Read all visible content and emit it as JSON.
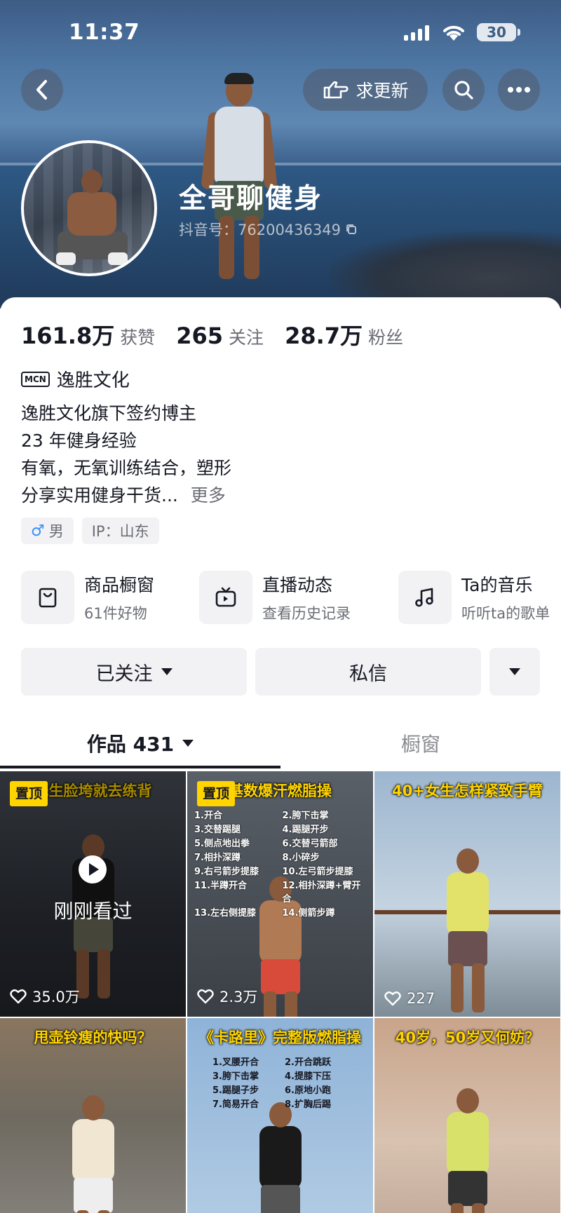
{
  "status_bar": {
    "time": "11:37",
    "battery": "30"
  },
  "header": {
    "update_label": "求更新",
    "name": "全哥聊健身",
    "douyin_id": "抖音号：76200436349"
  },
  "stats": [
    {
      "value": "161.8万",
      "label": "获赞"
    },
    {
      "value": "265",
      "label": "关注"
    },
    {
      "value": "28.7万",
      "label": "粉丝"
    }
  ],
  "mcn": {
    "badge": "MCN",
    "name": "逸胜文化"
  },
  "bio": {
    "lines": [
      "逸胜文化旗下签约博主",
      "23 年健身经验",
      "有氧，无氧训练结合，塑形",
      "分享实用健身干货..."
    ],
    "more": "更多"
  },
  "tags": [
    {
      "icon": "♂",
      "text": "男"
    },
    {
      "text": "IP：山东"
    }
  ],
  "features": [
    {
      "icon": "shopping-bag-icon",
      "title": "商品橱窗",
      "sub": "61件好物"
    },
    {
      "icon": "tv-icon",
      "title": "直播动态",
      "sub": "查看历史记录"
    },
    {
      "icon": "music-note-icon",
      "title": "Ta的音乐",
      "sub": "听听ta的歌单"
    }
  ],
  "actions": {
    "follow": "已关注",
    "message": "私信"
  },
  "tabs": {
    "works": "作品 431",
    "window": "橱窗"
  },
  "grid": [
    {
      "caption": "先生脸垮就去练背",
      "pinned": "置顶",
      "watched": "刚刚看过",
      "likes": "35.0万"
    },
    {
      "caption": "基数爆汗燃脂操",
      "pinned": "置顶",
      "likes": "2.3万",
      "exercises": [
        "1.开合",
        "2.胯下击掌",
        "3.交替踢腿",
        "4.踢腿开步",
        "5.侧点地出拳",
        "6.交替弓箭部",
        "7.相扑深蹲",
        "8.小碎步",
        "9.右弓箭步提膝",
        "10.左弓箭步提膝",
        "11.半蹲开合",
        "12.相扑深蹲+臂开合",
        "13.左右侧提膝",
        "14.侧箭步蹲"
      ]
    },
    {
      "caption": "40+女生怎样紧致手臂",
      "likes": "227"
    },
    {
      "caption": "甩壶铃瘦的快吗？"
    },
    {
      "caption": "《卡路里》完整版燃脂操",
      "exercises": [
        "1.叉腰开合",
        "2.开合跳跃",
        "3.胯下击掌",
        "4.提膝下压",
        "5.踢腿子步",
        "6.原地小跑",
        "7.简易开合",
        "8.扩胸后踢"
      ]
    },
    {
      "caption": "40岁，50岁又何妨？"
    }
  ]
}
